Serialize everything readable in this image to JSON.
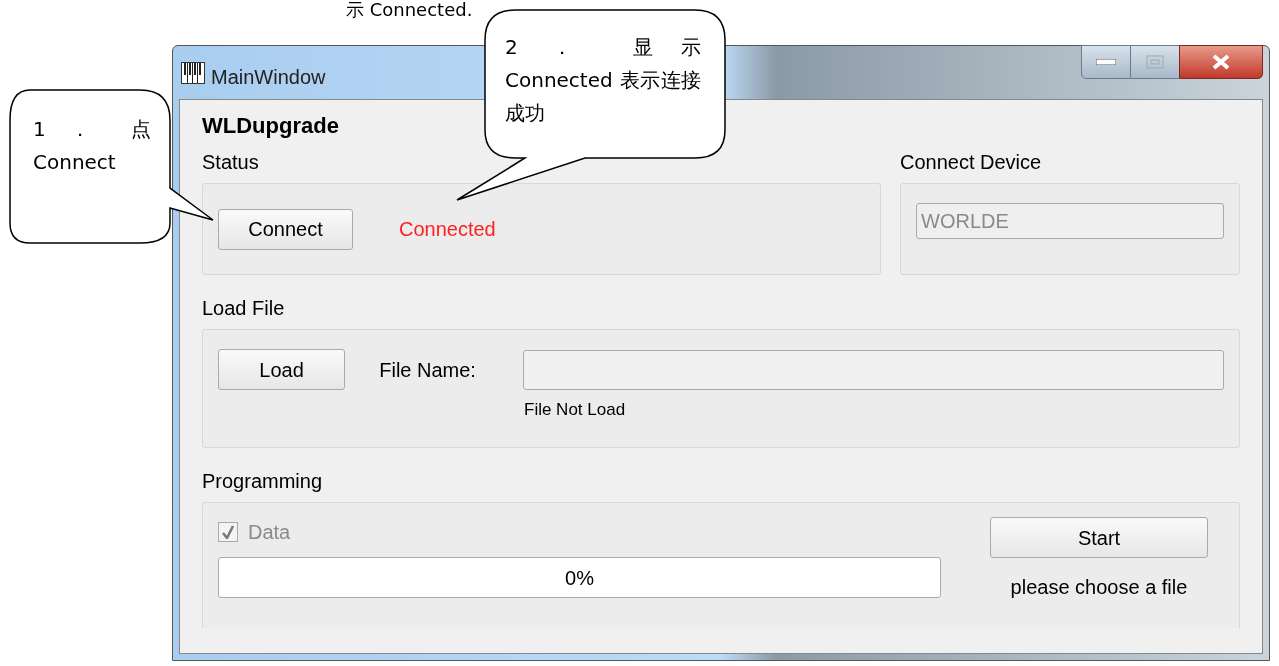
{
  "document_text": "示 Connected.",
  "window": {
    "title": "MainWindow",
    "app_title": "WLDupgrade"
  },
  "status": {
    "label": "Status",
    "button": "Connect",
    "state_text": "Connected",
    "connected": true
  },
  "connect_device": {
    "label": "Connect Device",
    "value": "WORLDE"
  },
  "load_file": {
    "label": "Load File",
    "button": "Load",
    "file_name_label": "File Name:",
    "message": "File Not Load"
  },
  "programming": {
    "label": "Programming",
    "checkbox": {
      "label": "Data",
      "checked": true,
      "disabled": true
    },
    "progress": {
      "level": 0,
      "text": "0%"
    },
    "button": "Start",
    "message": "please choose a file"
  },
  "callouts": [
    {
      "text": "1 ． 点 Connect",
      "kind": "left"
    },
    {
      "text": "2 ． 显示 Connected 表示连接成功",
      "kind": "top"
    }
  ]
}
